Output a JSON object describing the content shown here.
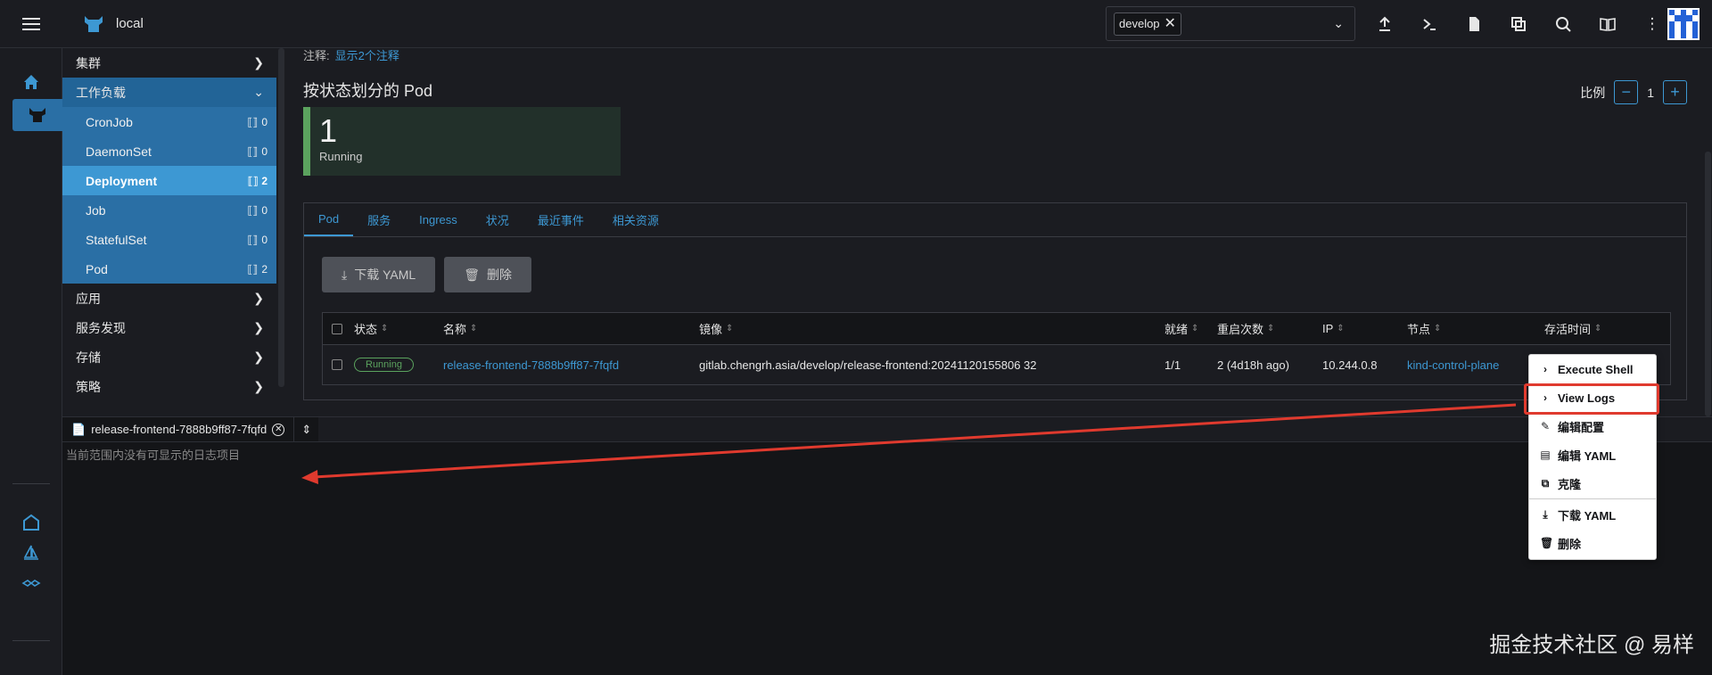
{
  "app": {
    "cluster_name": "local"
  },
  "namespace": {
    "selected": "develop"
  },
  "annotation": {
    "label": "注释:",
    "link": "显示2个注释"
  },
  "sidebar": {
    "groups": [
      {
        "label": "集群"
      },
      {
        "label": "工作负载"
      },
      {
        "label": "应用"
      },
      {
        "label": "服务发现"
      },
      {
        "label": "存储"
      },
      {
        "label": "策略"
      }
    ],
    "items": [
      {
        "label": "CronJob",
        "count": "0"
      },
      {
        "label": "DaemonSet",
        "count": "0"
      },
      {
        "label": "Deployment",
        "count": "2"
      },
      {
        "label": "Job",
        "count": "0"
      },
      {
        "label": "StatefulSet",
        "count": "0"
      },
      {
        "label": "Pod",
        "count": "2"
      }
    ]
  },
  "main": {
    "section_title": "按状态划分的 Pod",
    "scale_label": "比例",
    "scale_value": "1",
    "state_card": {
      "count": "1",
      "label": "Running"
    },
    "tabs": [
      "Pod",
      "服务",
      "Ingress",
      "状况",
      "最近事件",
      "相关资源"
    ],
    "buttons": {
      "download_yaml": "下载 YAML",
      "delete": "删除"
    },
    "table": {
      "headers": [
        "状态",
        "名称",
        "镜像",
        "就绪",
        "重启次数",
        "IP",
        "节点",
        "存活时间"
      ],
      "row": {
        "status": "Running",
        "name": "release-frontend-7888b9ff87-7fqfd",
        "image": "gitlab.chengrh.asia/develop/release-frontend:20241120155806 32",
        "ready": "1/1",
        "restarts": "2 (4d18h ago)",
        "ip": "10.244.0.8",
        "node": "kind-control-plane"
      }
    }
  },
  "context_menu": {
    "items": [
      "Execute Shell",
      "View Logs",
      "编辑配置",
      "编辑 YAML",
      "克隆",
      "下载 YAML",
      "删除"
    ]
  },
  "log_panel": {
    "tab_label": "release-frontend-7888b9ff87-7fqfd",
    "empty_text": "当前范围内没有可显示的日志项目"
  },
  "watermark": "掘金技术社区 @ 易样",
  "colors": {
    "accent": "#3d98d3",
    "running": "#5ba35e",
    "highlight": "#e03a2e"
  }
}
